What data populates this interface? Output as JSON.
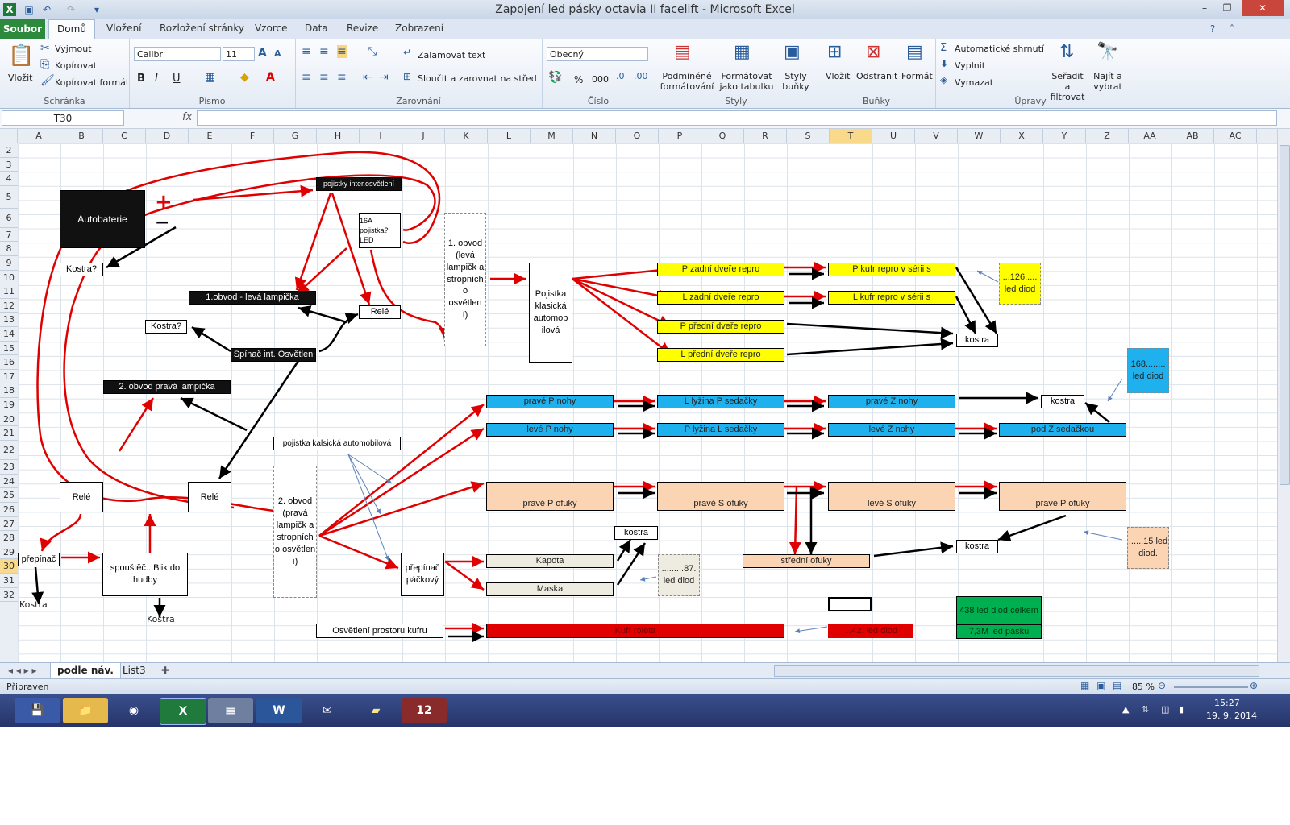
{
  "window": {
    "title": "Zapojení led pásky octavia II facelift - Microsoft Excel"
  },
  "tabs": {
    "file": "Soubor",
    "items": [
      "Domů",
      "Vložení",
      "Rozložení stránky",
      "Vzorce",
      "Data",
      "Revize",
      "Zobrazení"
    ]
  },
  "ribbon": {
    "clipboard": {
      "paste": "Vložit",
      "cut": "Vyjmout",
      "copy": "Kopírovat",
      "format_painter": "Kopírovat formát",
      "label": "Schránka"
    },
    "font": {
      "name": "Calibri",
      "size": "11",
      "label": "Písmo",
      "bold": "B",
      "italic": "I",
      "underline": "U"
    },
    "alignment": {
      "wrap": "Zalamovat text",
      "merge": "Sloučit a zarovnat na střed",
      "label": "Zarovnání"
    },
    "number": {
      "format": "Obecný",
      "label": "Číslo",
      "percent": "%",
      "thousands": "000"
    },
    "styles": {
      "conditional": "Podmíněné formátování",
      "table": "Formátovat jako tabulku",
      "cell_styles": "Styly buňky",
      "label": "Styly"
    },
    "cells": {
      "insert": "Vložit",
      "delete": "Odstranit",
      "format": "Formát",
      "label": "Buňky"
    },
    "editing": {
      "autosum": "Automatické shrnutí",
      "fill": "Vyplnit",
      "clear": "Vymazat",
      "sort": "Seřadit a filtrovat",
      "find": "Najít a vybrat",
      "label": "Úpravy"
    }
  },
  "formula_bar": {
    "name_box": "T30",
    "fx": "fx",
    "formula": ""
  },
  "columns": [
    "A",
    "B",
    "C",
    "D",
    "E",
    "F",
    "G",
    "H",
    "I",
    "J",
    "K",
    "L",
    "M",
    "N",
    "O",
    "P",
    "Q",
    "R",
    "S",
    "T",
    "U",
    "V",
    "W",
    "X",
    "Y",
    "Z",
    "AA",
    "AB",
    "AC"
  ],
  "selected_column": "T",
  "rows": [
    "2",
    "3",
    "4",
    "5",
    "6",
    "7",
    "8",
    "9",
    "10",
    "11",
    "12",
    "13",
    "14",
    "15",
    "16",
    "17",
    "18",
    "19",
    "20",
    "21",
    "22",
    "23",
    "24",
    "25",
    "26",
    "27",
    "28",
    "29",
    "30",
    "31",
    "32"
  ],
  "selected_row": "30",
  "diagram": {
    "autobaterie": "Autobaterie",
    "plus": "+",
    "minus": "−",
    "kostra1": "Kostra?",
    "pojistky_inter": "pojistky inter.osvětlení",
    "pojistka16a": "16A pojistka? LED",
    "obvod1_left": "1.obvod - levá lampička",
    "rele_top": "Relé",
    "kostra2": "Kostra?",
    "spinac": "Spínač int. Osvětlen",
    "obvod2_right": "2. obvod pravá lampička",
    "obvod1_desc": "1. obvod (levá lampičk a stropních o osvětlen í)",
    "pojistka_klas": "Pojistka klasická automob ilová",
    "pojistka_kalsicka": "pojistka kalsická automobilová",
    "obvod2_desc": "2. obvod (pravá lampičk a stropních o osvětlen í)",
    "rele_b": "Relé",
    "rele_e": "Relé",
    "prepinac": "přepínač",
    "spoustec": "spouštěč...Blik do hudby",
    "kostra_a": "Kostra",
    "kostra_d": "Kostra",
    "prepinac_packovy": "přepínač páčkový",
    "kapota": "Kapota",
    "maska": "Maska",
    "kostra_o": "kostra",
    "note87": ".........87. led diod",
    "p_zadni": "P zadní dveře repro",
    "l_zadni": "L zadní dveře repro",
    "p_predni": "P přední dveře repro",
    "l_predni": "L přední dveře repro",
    "p_kufr": "P kufr repro v sérii s",
    "l_kufr": "L kufr repro v sérii s",
    "kostra_w": "kostra",
    "note126": "...126..... led diod",
    "prave_p_nohy": "pravé P nohy",
    "leve_p_nohy": "levé P nohy",
    "l_lyzina": "L lyžina P sedačky",
    "p_lyzina": "P lyžina L sedačky",
    "prave_z_nohy": "pravé Z nohy",
    "leve_z_nohy": "levé Z nohy",
    "kostra_y": "kostra",
    "pod_z": "pod Z sedačkou",
    "note168": "168........ led diod",
    "prave_p_ofuky": "pravé P ofuky",
    "prave_s_ofuky": "pravé S ofuky",
    "leve_s_ofuky": "levé S ofuky",
    "prave_p_ofuky2": "pravé P ofuky",
    "stredni_ofuky": "střední ofuky",
    "kostra_w2": "kostra",
    "note15": "......15 led diod.",
    "osvetleni_kufru": "Osvětlení prostoru kufru",
    "kufr_roleta": "Kufr roleta",
    "note42": "...42. led diod",
    "total_leds": "438 led diod celkem",
    "total_len": "7,3M led pásku"
  },
  "sheets": {
    "active": "podle náv.",
    "other": "List3"
  },
  "status": {
    "ready": "Připraven",
    "zoom": "85 %"
  },
  "taskbar": {
    "time": "15:27",
    "date": "19. 9. 2014"
  },
  "colors": {
    "ribbon_green": "#2d8a3c",
    "yellow": "#ffff00",
    "cyan": "#1fb0ee",
    "peach": "#fbd4b4",
    "red": "#e00000",
    "green": "#00b050",
    "taskbar": "#2b3a74"
  }
}
